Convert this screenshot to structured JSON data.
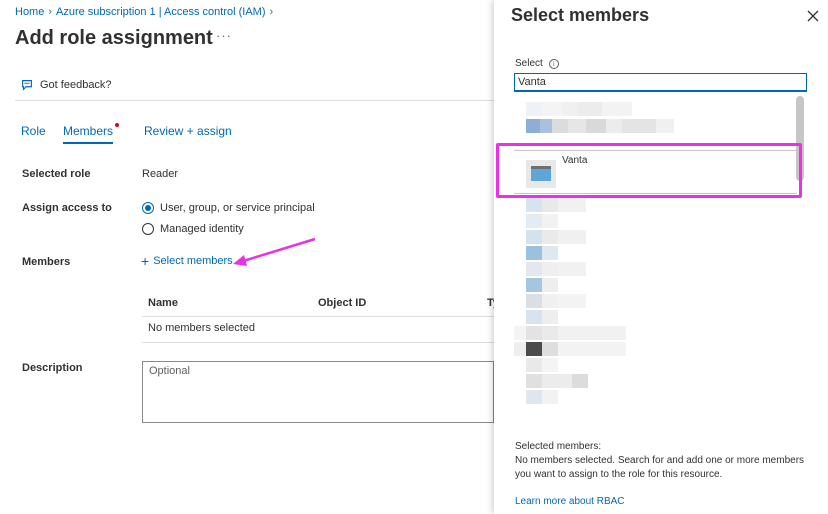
{
  "breadcrumb": {
    "home": "Home",
    "iam": "Azure subscription 1 | Access control (IAM)"
  },
  "page": {
    "title": "Add role assignment",
    "more": "···"
  },
  "toolbar": {
    "feedback": "Got feedback?"
  },
  "tabs": [
    {
      "label": "Role"
    },
    {
      "label": "Members",
      "active": true
    },
    {
      "label": "Review + assign"
    }
  ],
  "form": {
    "selected_role_label": "Selected role",
    "selected_role_value": "Reader",
    "assign_access_label": "Assign access to",
    "options": [
      {
        "label": "User, group, or service principal",
        "checked": true
      },
      {
        "label": "Managed identity",
        "checked": false
      }
    ],
    "members_label": "Members",
    "select_members": "Select members",
    "grid": {
      "name": "Name",
      "object_id": "Object ID",
      "type": "Ty",
      "empty": "No members selected"
    },
    "description_label": "Description",
    "description_placeholder": "Optional"
  },
  "panel": {
    "title": "Select members",
    "select_label": "Select",
    "search_value": "Vanta",
    "result_name": "Vanta",
    "selected_header": "Selected members:",
    "selected_text": "No members selected. Search for and add one or more members you want to assign to the role for this resource.",
    "learn_more": "Learn more about RBAC"
  },
  "colors": {
    "accent": "#0067b8",
    "highlight": "#e633e6"
  }
}
